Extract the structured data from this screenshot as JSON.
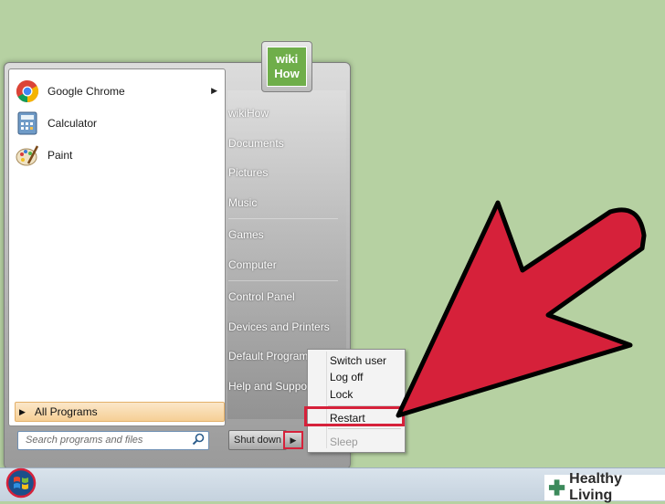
{
  "start_menu": {
    "programs": [
      {
        "label": "Google Chrome",
        "icon": "chrome-icon",
        "has_submenu": true
      },
      {
        "label": "Calculator",
        "icon": "calculator-icon",
        "has_submenu": false
      },
      {
        "label": "Paint",
        "icon": "paint-icon",
        "has_submenu": false
      }
    ],
    "all_programs_label": "All Programs",
    "search_placeholder": "Search programs and files",
    "right_links": [
      "wikiHow",
      "Documents",
      "Pictures",
      "Music",
      "Games",
      "Computer",
      "Control Panel",
      "Devices and Printers",
      "Default Programs",
      "Help and Support"
    ],
    "user_picture_text": [
      "wiki",
      "How"
    ],
    "shutdown_label": "Shut down"
  },
  "power_menu": {
    "items": [
      "Switch user",
      "Log off",
      "Lock",
      "Restart",
      "Sleep"
    ],
    "highlighted": "Restart",
    "disabled": "Sleep"
  },
  "watermark": {
    "text": "Healthy Living"
  },
  "colors": {
    "background": "#b6d1a2",
    "annotation_red": "#d6213a",
    "highlight_orange": "#f6cf95"
  }
}
